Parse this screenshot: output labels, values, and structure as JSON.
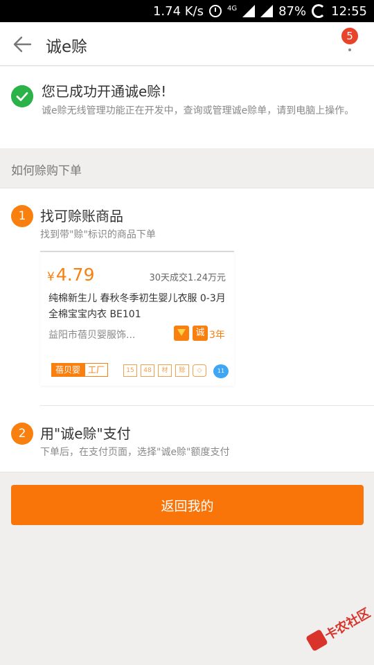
{
  "status_bar": {
    "speed": "1.74 K/s",
    "network": "4G",
    "battery": "87%",
    "time": "12:55"
  },
  "app_bar": {
    "title": "诚e赊",
    "badge_count": "5"
  },
  "success": {
    "title": "您已成功开通诚e赊!",
    "description": "诚e赊无线管理功能正在开发中，查询或管理诚e赊单，请到电脑上操作。"
  },
  "section": {
    "header": "如何赊购下单"
  },
  "steps": [
    {
      "number": "1",
      "title": "找可赊账商品",
      "description": "找到带\"赊\"标识的商品下单"
    },
    {
      "number": "2",
      "title": "用\"诚e赊\"支付",
      "description": "下单后，在支付页面，选择\"诚e赊\"额度支付"
    }
  ],
  "product": {
    "currency": "¥",
    "price": "4.79",
    "sold": "30天成交1.24万元",
    "name": "纯棉新生儿 春秋冬季初生婴儿衣服 0-3月全棉宝宝内衣 BE101",
    "shop": "益阳市蓓贝婴服饰...",
    "cheng_label": "诚",
    "years": "3年",
    "brand_a": "蓓贝婴",
    "brand_b": "工厂",
    "chips": [
      "15",
      "48",
      "材",
      "赊",
      "◇"
    ],
    "bubble": "11"
  },
  "return_button": "返回我的",
  "watermark": "卡农社区",
  "colors": {
    "accent": "#f97f0f",
    "success_green": "#2bb34a",
    "badge_red": "#e8442c"
  }
}
